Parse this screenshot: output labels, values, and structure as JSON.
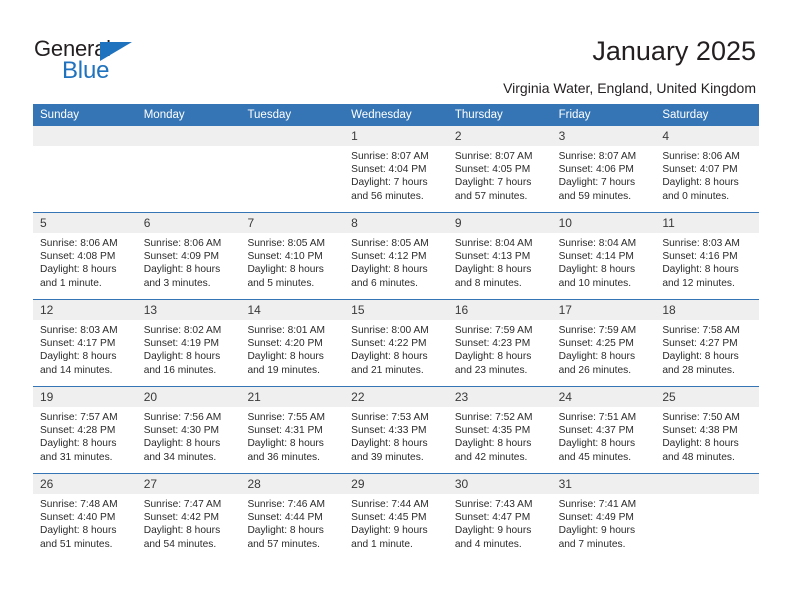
{
  "brand": {
    "name_line1": "General",
    "name_line2": "Blue",
    "accent_color": "#1f72bd"
  },
  "header": {
    "title": "January 2025",
    "subtitle": "Virginia Water, England, United Kingdom"
  },
  "calendar": {
    "header_color": "#3575b5",
    "daynum_band_color": "#efefef",
    "weekdays": [
      "Sunday",
      "Monday",
      "Tuesday",
      "Wednesday",
      "Thursday",
      "Friday",
      "Saturday"
    ],
    "weeks": [
      [
        {
          "day": "",
          "lines": []
        },
        {
          "day": "",
          "lines": []
        },
        {
          "day": "",
          "lines": []
        },
        {
          "day": "1",
          "lines": [
            "Sunrise: 8:07 AM",
            "Sunset: 4:04 PM",
            "Daylight: 7 hours",
            "and 56 minutes."
          ]
        },
        {
          "day": "2",
          "lines": [
            "Sunrise: 8:07 AM",
            "Sunset: 4:05 PM",
            "Daylight: 7 hours",
            "and 57 minutes."
          ]
        },
        {
          "day": "3",
          "lines": [
            "Sunrise: 8:07 AM",
            "Sunset: 4:06 PM",
            "Daylight: 7 hours",
            "and 59 minutes."
          ]
        },
        {
          "day": "4",
          "lines": [
            "Sunrise: 8:06 AM",
            "Sunset: 4:07 PM",
            "Daylight: 8 hours",
            "and 0 minutes."
          ]
        }
      ],
      [
        {
          "day": "5",
          "lines": [
            "Sunrise: 8:06 AM",
            "Sunset: 4:08 PM",
            "Daylight: 8 hours",
            "and 1 minute."
          ]
        },
        {
          "day": "6",
          "lines": [
            "Sunrise: 8:06 AM",
            "Sunset: 4:09 PM",
            "Daylight: 8 hours",
            "and 3 minutes."
          ]
        },
        {
          "day": "7",
          "lines": [
            "Sunrise: 8:05 AM",
            "Sunset: 4:10 PM",
            "Daylight: 8 hours",
            "and 5 minutes."
          ]
        },
        {
          "day": "8",
          "lines": [
            "Sunrise: 8:05 AM",
            "Sunset: 4:12 PM",
            "Daylight: 8 hours",
            "and 6 minutes."
          ]
        },
        {
          "day": "9",
          "lines": [
            "Sunrise: 8:04 AM",
            "Sunset: 4:13 PM",
            "Daylight: 8 hours",
            "and 8 minutes."
          ]
        },
        {
          "day": "10",
          "lines": [
            "Sunrise: 8:04 AM",
            "Sunset: 4:14 PM",
            "Daylight: 8 hours",
            "and 10 minutes."
          ]
        },
        {
          "day": "11",
          "lines": [
            "Sunrise: 8:03 AM",
            "Sunset: 4:16 PM",
            "Daylight: 8 hours",
            "and 12 minutes."
          ]
        }
      ],
      [
        {
          "day": "12",
          "lines": [
            "Sunrise: 8:03 AM",
            "Sunset: 4:17 PM",
            "Daylight: 8 hours",
            "and 14 minutes."
          ]
        },
        {
          "day": "13",
          "lines": [
            "Sunrise: 8:02 AM",
            "Sunset: 4:19 PM",
            "Daylight: 8 hours",
            "and 16 minutes."
          ]
        },
        {
          "day": "14",
          "lines": [
            "Sunrise: 8:01 AM",
            "Sunset: 4:20 PM",
            "Daylight: 8 hours",
            "and 19 minutes."
          ]
        },
        {
          "day": "15",
          "lines": [
            "Sunrise: 8:00 AM",
            "Sunset: 4:22 PM",
            "Daylight: 8 hours",
            "and 21 minutes."
          ]
        },
        {
          "day": "16",
          "lines": [
            "Sunrise: 7:59 AM",
            "Sunset: 4:23 PM",
            "Daylight: 8 hours",
            "and 23 minutes."
          ]
        },
        {
          "day": "17",
          "lines": [
            "Sunrise: 7:59 AM",
            "Sunset: 4:25 PM",
            "Daylight: 8 hours",
            "and 26 minutes."
          ]
        },
        {
          "day": "18",
          "lines": [
            "Sunrise: 7:58 AM",
            "Sunset: 4:27 PM",
            "Daylight: 8 hours",
            "and 28 minutes."
          ]
        }
      ],
      [
        {
          "day": "19",
          "lines": [
            "Sunrise: 7:57 AM",
            "Sunset: 4:28 PM",
            "Daylight: 8 hours",
            "and 31 minutes."
          ]
        },
        {
          "day": "20",
          "lines": [
            "Sunrise: 7:56 AM",
            "Sunset: 4:30 PM",
            "Daylight: 8 hours",
            "and 34 minutes."
          ]
        },
        {
          "day": "21",
          "lines": [
            "Sunrise: 7:55 AM",
            "Sunset: 4:31 PM",
            "Daylight: 8 hours",
            "and 36 minutes."
          ]
        },
        {
          "day": "22",
          "lines": [
            "Sunrise: 7:53 AM",
            "Sunset: 4:33 PM",
            "Daylight: 8 hours",
            "and 39 minutes."
          ]
        },
        {
          "day": "23",
          "lines": [
            "Sunrise: 7:52 AM",
            "Sunset: 4:35 PM",
            "Daylight: 8 hours",
            "and 42 minutes."
          ]
        },
        {
          "day": "24",
          "lines": [
            "Sunrise: 7:51 AM",
            "Sunset: 4:37 PM",
            "Daylight: 8 hours",
            "and 45 minutes."
          ]
        },
        {
          "day": "25",
          "lines": [
            "Sunrise: 7:50 AM",
            "Sunset: 4:38 PM",
            "Daylight: 8 hours",
            "and 48 minutes."
          ]
        }
      ],
      [
        {
          "day": "26",
          "lines": [
            "Sunrise: 7:48 AM",
            "Sunset: 4:40 PM",
            "Daylight: 8 hours",
            "and 51 minutes."
          ]
        },
        {
          "day": "27",
          "lines": [
            "Sunrise: 7:47 AM",
            "Sunset: 4:42 PM",
            "Daylight: 8 hours",
            "and 54 minutes."
          ]
        },
        {
          "day": "28",
          "lines": [
            "Sunrise: 7:46 AM",
            "Sunset: 4:44 PM",
            "Daylight: 8 hours",
            "and 57 minutes."
          ]
        },
        {
          "day": "29",
          "lines": [
            "Sunrise: 7:44 AM",
            "Sunset: 4:45 PM",
            "Daylight: 9 hours",
            "and 1 minute."
          ]
        },
        {
          "day": "30",
          "lines": [
            "Sunrise: 7:43 AM",
            "Sunset: 4:47 PM",
            "Daylight: 9 hours",
            "and 4 minutes."
          ]
        },
        {
          "day": "31",
          "lines": [
            "Sunrise: 7:41 AM",
            "Sunset: 4:49 PM",
            "Daylight: 9 hours",
            "and 7 minutes."
          ]
        },
        {
          "day": "",
          "lines": []
        }
      ]
    ]
  }
}
